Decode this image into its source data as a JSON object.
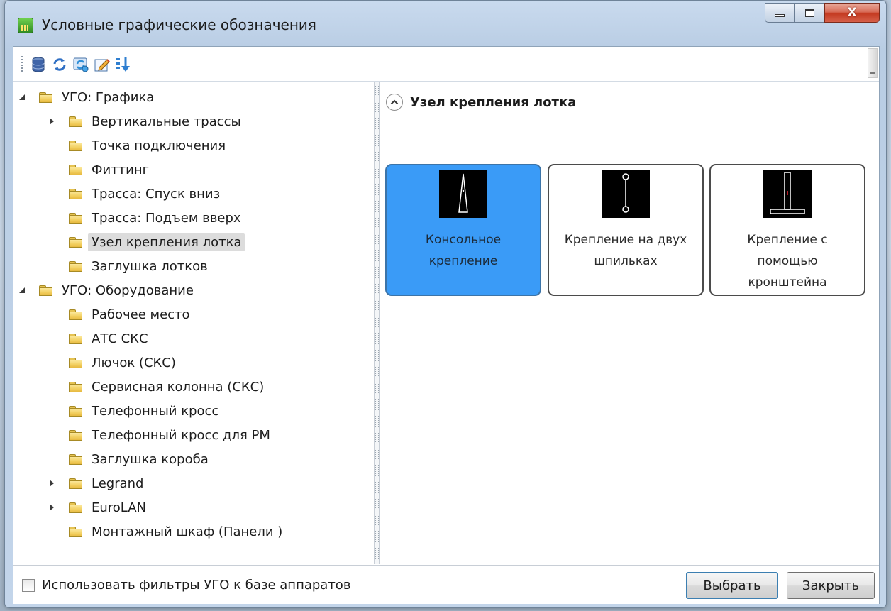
{
  "window": {
    "title": "Условные графические обозначения",
    "caption_buttons": {
      "minimize": "minimize",
      "maximize": "maximize",
      "close": "X"
    }
  },
  "toolbar": {
    "buttons": [
      {
        "icon": "database-icon"
      },
      {
        "icon": "refresh-icon"
      },
      {
        "icon": "sync-icon"
      },
      {
        "icon": "edit-icon"
      },
      {
        "icon": "sort-icon"
      }
    ]
  },
  "tree": {
    "nodes": [
      {
        "label": "УГО: Графика",
        "level": 0,
        "expander": "expanded"
      },
      {
        "label": "Вертикальные трассы",
        "level": 1,
        "expander": "collapsed"
      },
      {
        "label": "Точка подключения",
        "level": 1,
        "expander": "none"
      },
      {
        "label": "Фиттинг",
        "level": 1,
        "expander": "none"
      },
      {
        "label": "Трасса: Спуск вниз",
        "level": 1,
        "expander": "none"
      },
      {
        "label": "Трасса: Подъем вверх",
        "level": 1,
        "expander": "none"
      },
      {
        "label": "Узел крепления лотка",
        "level": 1,
        "expander": "none",
        "selected": true
      },
      {
        "label": "Заглушка лотков",
        "level": 1,
        "expander": "none"
      },
      {
        "label": "УГО: Оборудование",
        "level": 0,
        "expander": "expanded"
      },
      {
        "label": "Рабочее место",
        "level": 1,
        "expander": "none"
      },
      {
        "label": "АТС СКС",
        "level": 1,
        "expander": "none"
      },
      {
        "label": "Лючок (СКС)",
        "level": 1,
        "expander": "none"
      },
      {
        "label": "Сервисная колонна (СКС)",
        "level": 1,
        "expander": "none"
      },
      {
        "label": "Телефонный кросс",
        "level": 1,
        "expander": "none"
      },
      {
        "label": "Телефонный кросс для РМ",
        "level": 1,
        "expander": "none"
      },
      {
        "label": "Заглушка короба",
        "level": 1,
        "expander": "none"
      },
      {
        "label": "Legrand",
        "level": 1,
        "expander": "collapsed"
      },
      {
        "label": "EuroLAN",
        "level": 1,
        "expander": "collapsed"
      },
      {
        "label": "Монтажный шкаф (Панели )",
        "level": 1,
        "expander": "none"
      }
    ]
  },
  "content": {
    "group_title": "Узел крепления лотка",
    "items": [
      {
        "label_lines": [
          "Консольное",
          "крепление"
        ],
        "selected": true,
        "symbol": "console-mount-symbol"
      },
      {
        "label_lines": [
          "Крепление на двух",
          "шпильках"
        ],
        "selected": false,
        "symbol": "two-stud-mount-symbol"
      },
      {
        "label_lines": [
          "Крепление с",
          "помощью",
          "кронштейна"
        ],
        "selected": false,
        "symbol": "bracket-mount-symbol"
      }
    ]
  },
  "footer": {
    "checkbox_label": "Использовать фильтры УГО к базе аппаратов",
    "checkbox_checked": false,
    "select_button": "Выбрать",
    "close_button": "Закрыть"
  },
  "colors": {
    "selected_tile": "#3a9bf7",
    "selected_tree_item": "#dcdcdc",
    "close_button": "#c43b22"
  }
}
